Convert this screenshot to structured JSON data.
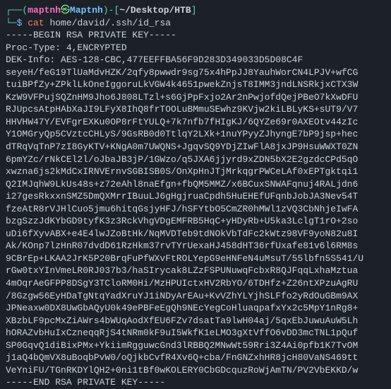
{
  "prompt": {
    "open_dash": "┌──",
    "open_paren": "(",
    "user": "maptnh",
    "symbol": "㉿",
    "host": "Maptnh",
    "close_paren": ")",
    "dash_bracket": "-[",
    "path": "~/Desktop/HTB",
    "close_bracket": "]",
    "pipe_corner": "└─",
    "dollar": "$",
    "command": "cat",
    "argument": "home/david/.ssh/id_rsa"
  },
  "output": {
    "begin": "-----BEGIN RSA PRIVATE KEY-----",
    "proc_type": "Proc-Type: 4,ENCRYPTED",
    "dek_info": "DEK-Info: AES-128-CBC,477EEFFBA56F9D283D349033D5D08C4F",
    "blank": "",
    "key_lines": [
      "seyeH/feG19TlUaMdvHZK/2qfy8pwwdr9sg75x4hPpJJ8YauhWorCN4LPJV+wfCG",
      "tuiBPfZy+ZPklLkOneIggoruLkVGW4k4651pwekZnjsT8IMM3jndLNSRkjxCTX3W",
      "KzW9VFPujSQZnHM9Jho6J808LTzl+s6GjPpFxjo2Ar2nPwjofdQejPBeO7kXwDFU",
      "RJUpcsAtpHAbXaJI9LFyX8IhQ8frTOOLuBMmuSEwhz9KVjw2kiLBLyKS+sUT9/V7",
      "HHVHW47Y/EVFgrEXKu0OP8rFtYULQ+7k7nfb7fHIgKJ/6QYZe69r0AXEOtv44zIc",
      "Y1OMGryQp5CVztcCHLyS/9GsRB0d0TtlqY2LXk+1nuYPyyZJhyngE7bP9jsp+hec",
      "dTRqVqTnP7zI8GyKTV+KNgA0m7UWQNS+JgqvSQ9YDjZIwFlA8jxJP9HsuWWXT0ZN",
      "6pmYZc/rNkCEl2l/oJbaJB3jP/1GWzo/q5JXA6jjyrd9xZDN5bX2E2gzdcCPd5qO",
      "xwzna6js2kMdCxIRNVErnvSGBISB0S/OnXpHnJTjMrkqgrPWCeLAf0xEPTgktqi1",
      "Q2IMJqhW9LkUs48s+z72eAhl8naEfgn+fbQM5MMZ/x6BCuxSNWAFqnuj4RALjdn6",
      "i27gesRkxxnSMZ5DmQXMrrIBuuLJ6gHgjruaCpdh5HuEHEfUFqnbJobJA3Nev54T",
      "fzeAtR8rVJHlCuo5jmu6hitqGsjyHFJ/hSFYtbO5CmZR0hMWl1zVQ3CbNhjeIwFA",
      "bzgSzzJdKYbGD9tyfK3z3RckVhgVDgEMFRB5HqC+yHDyRb+U5ka3LclgT1rO+2so",
      "uDi6fXyvABX+e4E4lwJZoBtHk/NqMVDTeb9tdNOkVbTdFc2kWtz98VF9yoN82u8I",
      "Ak/KOnp7lzHnR07dvdD61RzHkm37rvTYrUexaHJ458dHT36rfUxafe81v6l6RM8s",
      "9CBrEp+LKAA2JrK5P20BrqFuPfWXvFtROLYepG9eHNFeN4uMsuT/55lbfn5S541/U",
      "rGw0txYInVmeLR0RJ037b3/haSIrycak8LZzFSPUNuwqFcbxR8QJFqqLxhaMztua",
      "4mOqrAeGFPP8DSgY3TCloRM0Hi/MzHPUIctxHV2RbYO/6TDHfz+Z26ntXPzuAgRU",
      "/8Gzgw56EyHDaTgNtqYadXruYJ1iNDyArEAu+KvVZhYLYjhSLFfo2yRdOuGBm9AX",
      "JPNeaxw0DX8UwGbAQyU0k49ePBFeEgQh9NEcYegCoHluaqpafxYx2c5MpY1nRg8+",
      "XBzbLF9pcMxZiAWrs4bWUqAodXfEU6FZv7dsatTa9lwH04aj/5qxEbJuwuAuW5Lh",
      "hORAZvbHuIxCzneqqRjS4tNRm0kF9uI5WkfK1eLMO3gXtVffO6vDD3mcTNL1pQuf",
      "SP0GqvQ1diBixPMx+YkiimRgguwcGnd3lRBBQ2MNwWt59Rri3Z4Ai0pfb1K7TvOM",
      "j1aQ4bQmVX8uBoqbPvW0/oQjkbCvfR4Xv6Q+cba/FnGNZxhHR8jcH80VaNS469tt",
      "VeYniFU/TGnRKDYlQH2+0ni1tBf0wKOLERY0CbGDcquzRoWjAmTN/PV2VbEKKD/w"
    ],
    "end": "-----END RSA PRIVATE KEY-----"
  }
}
